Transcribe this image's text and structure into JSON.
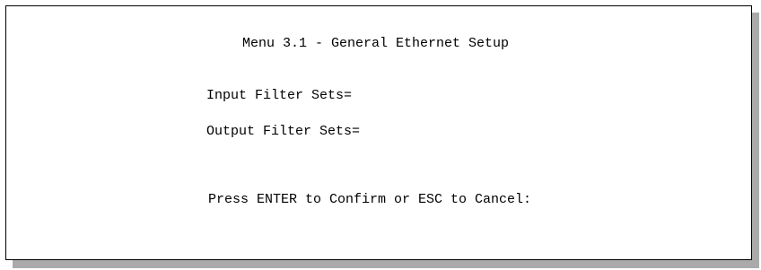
{
  "menu": {
    "title": "Menu 3.1 - General Ethernet Setup",
    "fields": [
      {
        "label": "Input Filter Sets=",
        "value": ""
      },
      {
        "label": "Output Filter Sets=",
        "value": ""
      }
    ],
    "prompt": "Press ENTER to Confirm or ESC to Cancel:"
  }
}
